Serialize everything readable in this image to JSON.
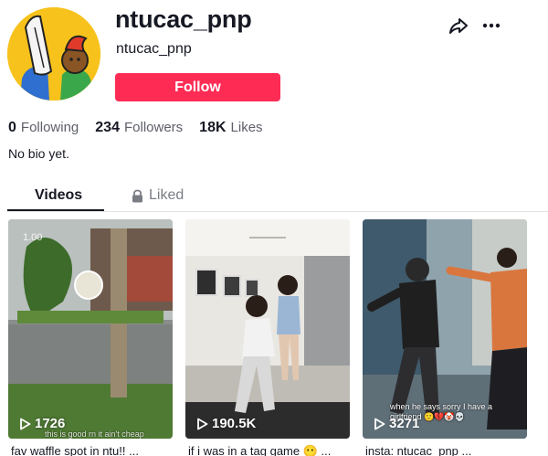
{
  "profile": {
    "username": "ntucac_pnp",
    "nickname": "ntucac_pnp",
    "follow_label": "Follow",
    "bio": "No bio yet.",
    "stats": [
      {
        "value": "0",
        "label": "Following"
      },
      {
        "value": "234",
        "label": "Followers"
      },
      {
        "value": "18K",
        "label": "Likes"
      }
    ]
  },
  "header_icons": [
    "share-icon",
    "more-icon"
  ],
  "tabs": [
    {
      "label": "Videos",
      "active": true
    },
    {
      "label": "Liked",
      "icon": "lock-icon",
      "active": false
    }
  ],
  "videos": [
    {
      "views": "1726",
      "caption": "fav waffle spot in ntu!! ...",
      "timer": "1.00",
      "overlay": "this is good rn it ain't cheap"
    },
    {
      "views": "190.5K",
      "caption": "if i was in a tag game 😶 ..."
    },
    {
      "views": "3271",
      "caption": "insta: ntucac_pnp ...",
      "overlay": "when he says sorry I have a girlfriend 🙂💔🤡💀"
    }
  ],
  "colors": {
    "accent": "#fe2c55",
    "text": "#161823",
    "muted": "#5e6069",
    "avatar_bg": "#f7c21b"
  }
}
